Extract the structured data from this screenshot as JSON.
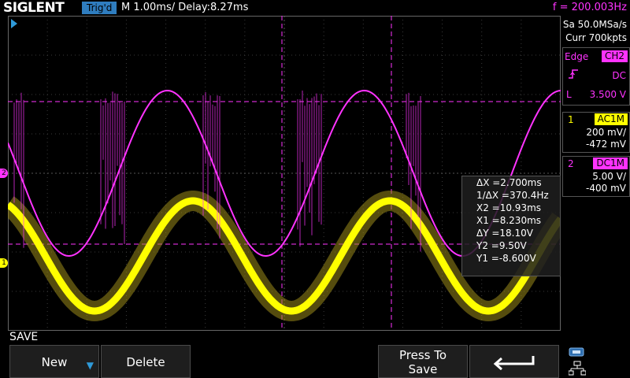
{
  "header": {
    "brand": "SIGLENT",
    "trigger_status": "Trig'd",
    "timebase": "M 1.00ms/ Delay:8.27ms",
    "frequency": "f = 200.003Hz"
  },
  "acquisition": {
    "sample_rate": "Sa 50.0MSa/s",
    "memory_depth": "Curr 700kpts"
  },
  "trigger": {
    "type": "Edge",
    "source": "CH2",
    "coupling": "DC",
    "slope_icon": "rising-edge-icon",
    "level_prefix": "L",
    "level": "3.500 V"
  },
  "channels": [
    {
      "number": "1",
      "coupling": "AC1M",
      "scale": "200 mV/",
      "offset": "-472 mV",
      "color": "#ffff00"
    },
    {
      "number": "2",
      "coupling": "DC1M",
      "scale": "5.00 V/",
      "offset": "-400 mV",
      "color": "#ff33ff"
    }
  ],
  "markers": {
    "ch1": "1",
    "ch2": "2"
  },
  "measurements": {
    "dx": "ΔX =2.700ms",
    "inv_dx": "1/ΔX =370.4Hz",
    "x2": "X2 =10.93ms",
    "x1": "X1 =8.230ms",
    "dy": "ΔY =18.10V",
    "y2": "Y2 =9.50V",
    "y1": "Y1 =-8.600V"
  },
  "menu": {
    "title": "SAVE",
    "softkeys": {
      "new": "New",
      "delete": "Delete",
      "press_to_save_line1": "Press To",
      "press_to_save_line2": "Save",
      "back_icon": "return-arrow-icon"
    }
  },
  "status": {
    "usb_icon": "usb-icon",
    "network_icon": "network-icon"
  }
}
